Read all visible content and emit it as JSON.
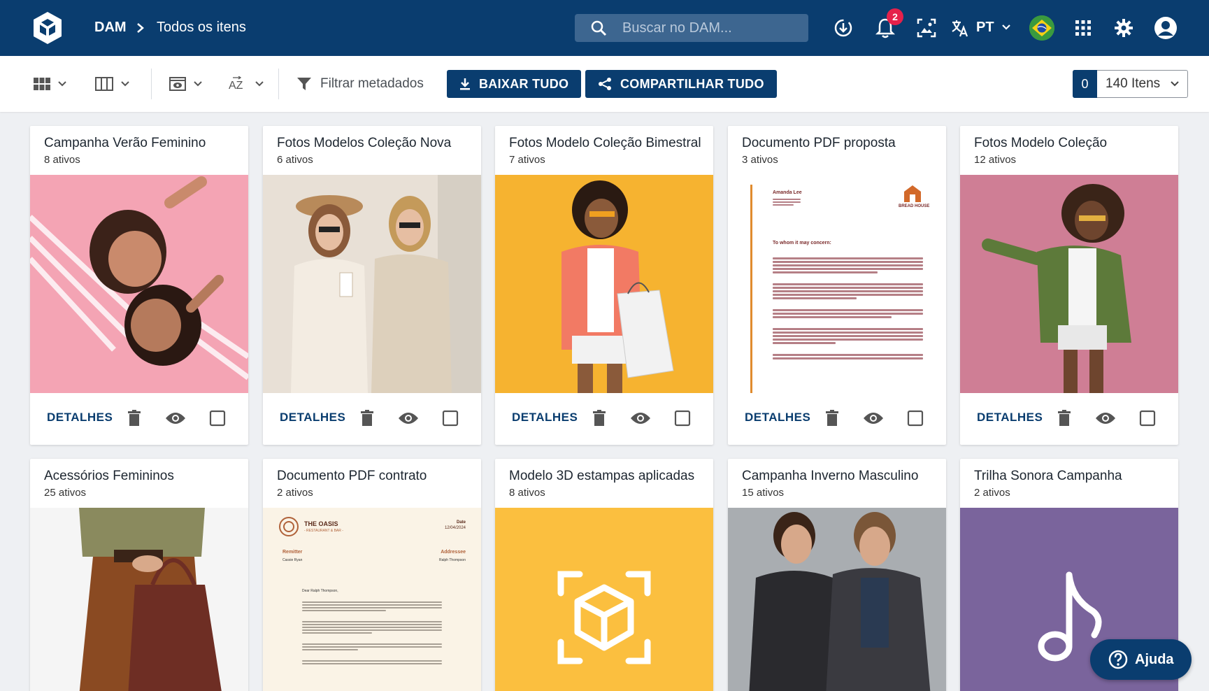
{
  "header": {
    "breadcrumb_root": "DAM",
    "breadcrumb_current": "Todos os itens",
    "search_placeholder": "Buscar no DAM...",
    "notification_count": "2",
    "language": "PT"
  },
  "toolbar": {
    "filter_label": "Filtrar metadados",
    "download_all_label": "BAIXAR TUDO",
    "share_all_label": "COMPARTILHAR TUDO",
    "selected_count": "0",
    "items_label": "140 Itens"
  },
  "cards": [
    {
      "title": "Campanha Verão Feminino",
      "subtitle": "8 ativos",
      "details_label": "DETALHES"
    },
    {
      "title": "Fotos Modelos Coleção Nova",
      "subtitle": "6 ativos",
      "details_label": "DETALHES"
    },
    {
      "title": "Fotos Modelo Coleção Bimestral",
      "subtitle": "7 ativos",
      "details_label": "DETALHES"
    },
    {
      "title": "Documento PDF proposta",
      "subtitle": "3 ativos",
      "details_label": "DETALHES"
    },
    {
      "title": "Fotos Modelo Coleção",
      "subtitle": "12 ativos",
      "details_label": "DETALHES"
    },
    {
      "title": "Acessórios Femininos",
      "subtitle": "25 ativos"
    },
    {
      "title": "Documento PDF contrato",
      "subtitle": "2 ativos"
    },
    {
      "title": "Modelo 3D estampas aplicadas",
      "subtitle": "8 ativos"
    },
    {
      "title": "Campanha Inverno Masculino",
      "subtitle": "15 ativos"
    },
    {
      "title": "Trilha Sonora Campanha",
      "subtitle": "2 ativos"
    }
  ],
  "doc_proposta": {
    "sender_name": "Amanda Lee",
    "brand": "BREAD HOUSE",
    "greeting": "To whom it may concern:"
  },
  "doc_contrato": {
    "brand": "THE OASIS",
    "brand_sub": "- RESTAURANT & BAR -",
    "date_label": "Date",
    "date_value": "12/04/2024",
    "remitter_label": "Remitter",
    "addressee_label": "Addressee",
    "remitter_name": "Cassie Ryan",
    "addressee_name": "Ralph Thompson",
    "greeting": "Dear Ralph Thompson,"
  },
  "help_label": "Ajuda",
  "colors": {
    "brand_navy": "#0a3d6f",
    "badge_red": "#e5214b"
  }
}
